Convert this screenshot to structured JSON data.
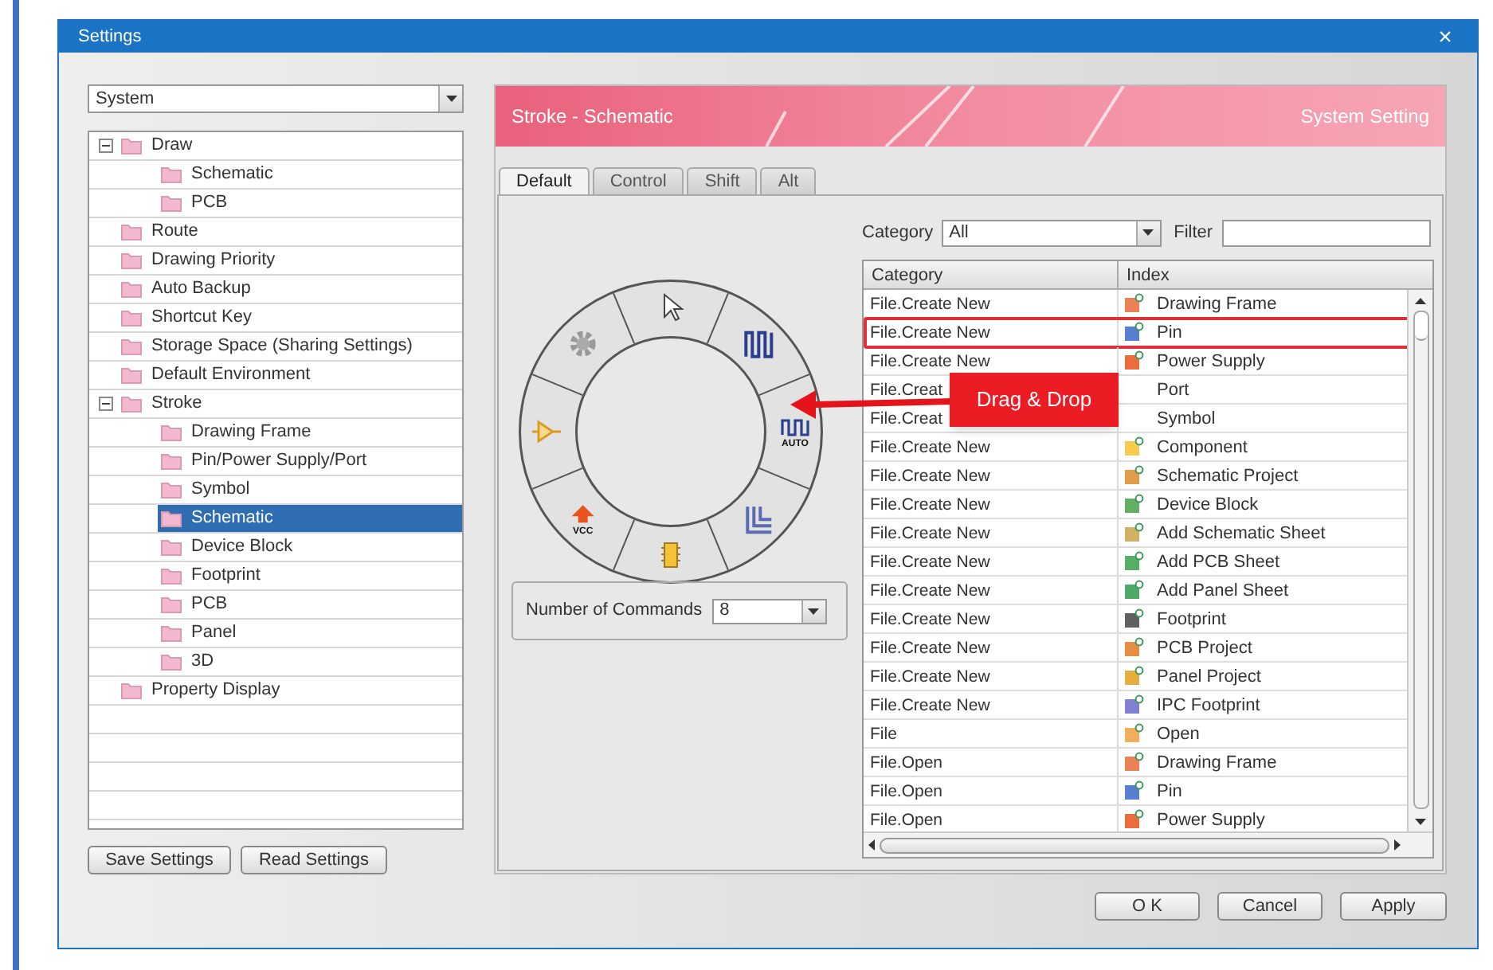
{
  "window": {
    "title": "Settings",
    "close": "×"
  },
  "sidebar": {
    "dropdown": {
      "value": "System"
    },
    "tree": [
      {
        "label": "Draw",
        "expanded": true,
        "selected": false,
        "children": [
          {
            "label": "Schematic",
            "selected": false
          },
          {
            "label": "PCB",
            "selected": false
          }
        ]
      },
      {
        "label": "Route",
        "selected": false
      },
      {
        "label": "Drawing Priority",
        "selected": false
      },
      {
        "label": "Auto Backup",
        "selected": false
      },
      {
        "label": "Shortcut Key",
        "selected": false
      },
      {
        "label": "Storage Space (Sharing Settings)",
        "selected": false
      },
      {
        "label": "Default Environment",
        "selected": false
      },
      {
        "label": "Stroke",
        "expanded": true,
        "selected": false,
        "children": [
          {
            "label": "Drawing Frame",
            "selected": false
          },
          {
            "label": "Pin/Power Supply/Port",
            "selected": false
          },
          {
            "label": "Symbol",
            "selected": false
          },
          {
            "label": "Schematic",
            "selected": true
          },
          {
            "label": "Device Block",
            "selected": false
          },
          {
            "label": "Footprint",
            "selected": false
          },
          {
            "label": "PCB",
            "selected": false
          },
          {
            "label": "Panel",
            "selected": false
          },
          {
            "label": "3D",
            "selected": false
          }
        ]
      },
      {
        "label": "Property Display",
        "selected": false
      }
    ],
    "buttons": [
      "Save Settings",
      "Read Settings"
    ]
  },
  "header": {
    "title": "Stroke - Schematic",
    "subtitle": "System Setting"
  },
  "tabs": [
    {
      "label": "Default",
      "selected": true
    },
    {
      "label": "Control",
      "selected": false
    },
    {
      "label": "Shift",
      "selected": false
    },
    {
      "label": "Alt",
      "selected": false
    }
  ],
  "radial_menu": {
    "slots": [
      {
        "kind": "cursor"
      },
      {
        "kind": "meander"
      },
      {
        "kind": "auto-route",
        "label": "AUTO"
      },
      {
        "kind": "bus"
      },
      {
        "kind": "chip"
      },
      {
        "kind": "power",
        "label": "VCC"
      },
      {
        "kind": "buffer"
      },
      {
        "kind": "gear"
      }
    ],
    "commands": {
      "label": "Number of Commands",
      "value": "8"
    }
  },
  "filter_bar": {
    "category_label": "Category",
    "category_value": "All",
    "filter_label": "Filter"
  },
  "table": {
    "columns": [
      "Category",
      "Index"
    ],
    "rows": [
      {
        "category": "File.Create New",
        "index": "Drawing Frame",
        "highlighted": false,
        "covered": false
      },
      {
        "category": "File.Create New",
        "index": "Pin",
        "highlighted": true,
        "covered": false
      },
      {
        "category": "File.Create New",
        "index": "Power Supply",
        "highlighted": false,
        "covered": false
      },
      {
        "category": "File.Creat",
        "index": "Port",
        "highlighted": false,
        "covered": true
      },
      {
        "category": "File.Creat",
        "index": "Symbol",
        "highlighted": false,
        "covered": true
      },
      {
        "category": "File.Create New",
        "index": "Component",
        "highlighted": false,
        "covered": false
      },
      {
        "category": "File.Create New",
        "index": "Schematic Project",
        "highlighted": false,
        "covered": false
      },
      {
        "category": "File.Create New",
        "index": "Device Block",
        "highlighted": false,
        "covered": false
      },
      {
        "category": "File.Create New",
        "index": "Add Schematic Sheet",
        "highlighted": false,
        "covered": false
      },
      {
        "category": "File.Create New",
        "index": "Add PCB Sheet",
        "highlighted": false,
        "covered": false
      },
      {
        "category": "File.Create New",
        "index": "Add Panel Sheet",
        "highlighted": false,
        "covered": false
      },
      {
        "category": "File.Create New",
        "index": "Footprint",
        "highlighted": false,
        "covered": false
      },
      {
        "category": "File.Create New",
        "index": "PCB Project",
        "highlighted": false,
        "covered": false
      },
      {
        "category": "File.Create New",
        "index": "Panel Project",
        "highlighted": false,
        "covered": false
      },
      {
        "category": "File.Create New",
        "index": "IPC Footprint",
        "highlighted": false,
        "covered": false
      },
      {
        "category": "File",
        "index": "Open",
        "highlighted": false,
        "covered": false
      },
      {
        "category": "File.Open",
        "index": "Drawing Frame",
        "highlighted": false,
        "covered": false
      },
      {
        "category": "File.Open",
        "index": "Pin",
        "highlighted": false,
        "covered": false
      },
      {
        "category": "File.Open",
        "index": "Power Supply",
        "highlighted": false,
        "covered": false
      }
    ]
  },
  "annotation": {
    "label": "Drag & Drop"
  },
  "buttons": [
    "O K",
    "Cancel",
    "Apply"
  ]
}
